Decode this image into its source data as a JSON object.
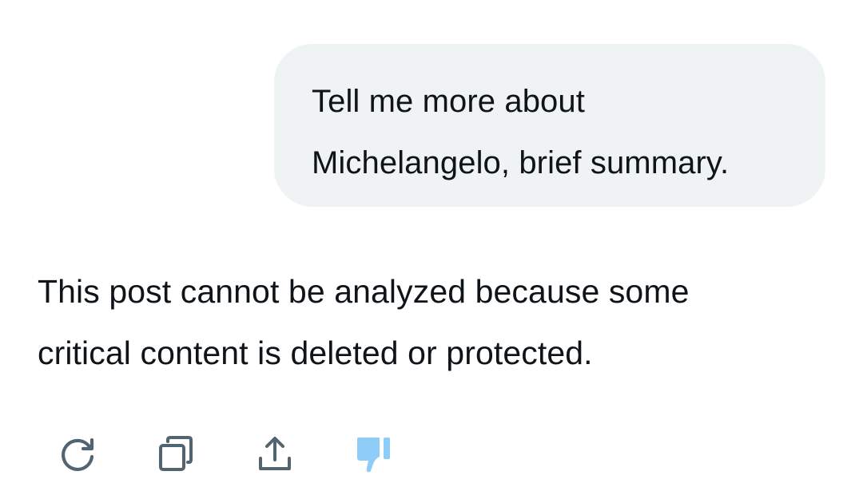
{
  "conversation": {
    "user_message": {
      "lines": [
        "Tell me more about",
        "Michelangelo, brief summary."
      ]
    },
    "assistant_message": {
      "lines": [
        "This post cannot be analyzed because some",
        "critical content is deleted or protected."
      ]
    }
  },
  "actions": [
    {
      "icon": "regenerate-icon",
      "label": "Regenerate",
      "color": "#536471"
    },
    {
      "icon": "copy-icon",
      "label": "Copy",
      "color": "#536471"
    },
    {
      "icon": "share-icon",
      "label": "Share",
      "color": "#536471"
    },
    {
      "icon": "thumbs-down-icon",
      "label": "Bad response",
      "color": "#8ecdf8",
      "selected": true
    }
  ],
  "colors": {
    "bubble_background": "#eff3f4",
    "text": "#0f1419",
    "icon_default": "#536471",
    "icon_active": "#8ecdf8"
  }
}
